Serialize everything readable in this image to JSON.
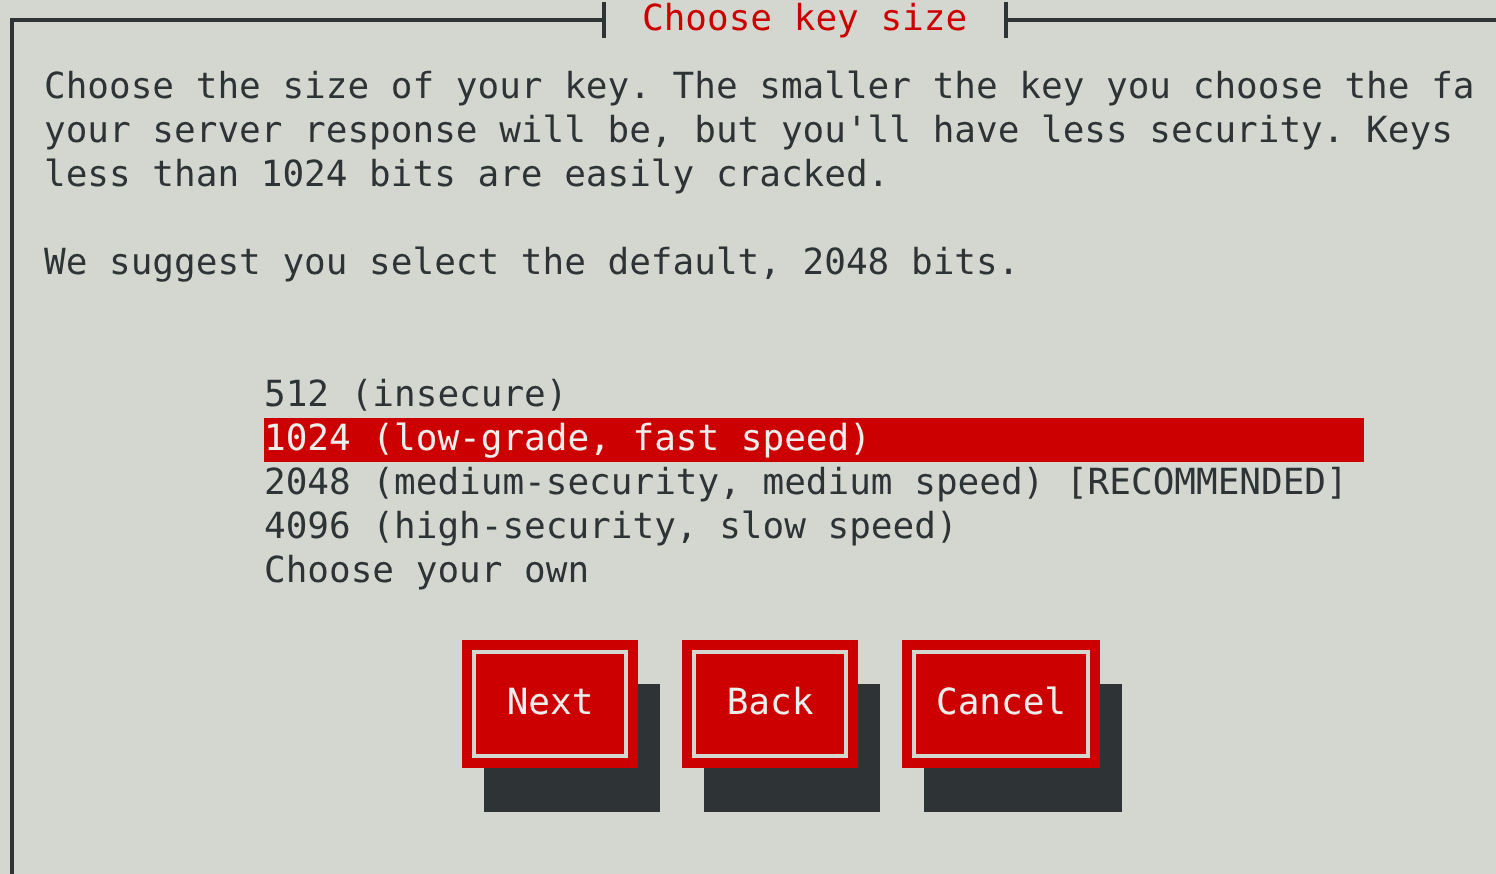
{
  "dialog": {
    "title": "Choose key size",
    "paragraphs": [
      "Choose the size of your key. The smaller the key you choose the fa\nyour server response will be, but you'll have less security. Keys\nless than 1024 bits are easily cracked.",
      "We suggest you select the default, 2048 bits."
    ],
    "options": [
      {
        "label": "512 (insecure)",
        "selected": false
      },
      {
        "label": "1024 (low-grade, fast speed)",
        "selected": true
      },
      {
        "label": "2048 (medium-security, medium speed) [RECOMMENDED]",
        "selected": false
      },
      {
        "label": "4096 (high-security, slow speed)",
        "selected": false
      },
      {
        "label": "Choose your own",
        "selected": false
      }
    ],
    "buttons": [
      "Next",
      "Back",
      "Cancel"
    ]
  }
}
